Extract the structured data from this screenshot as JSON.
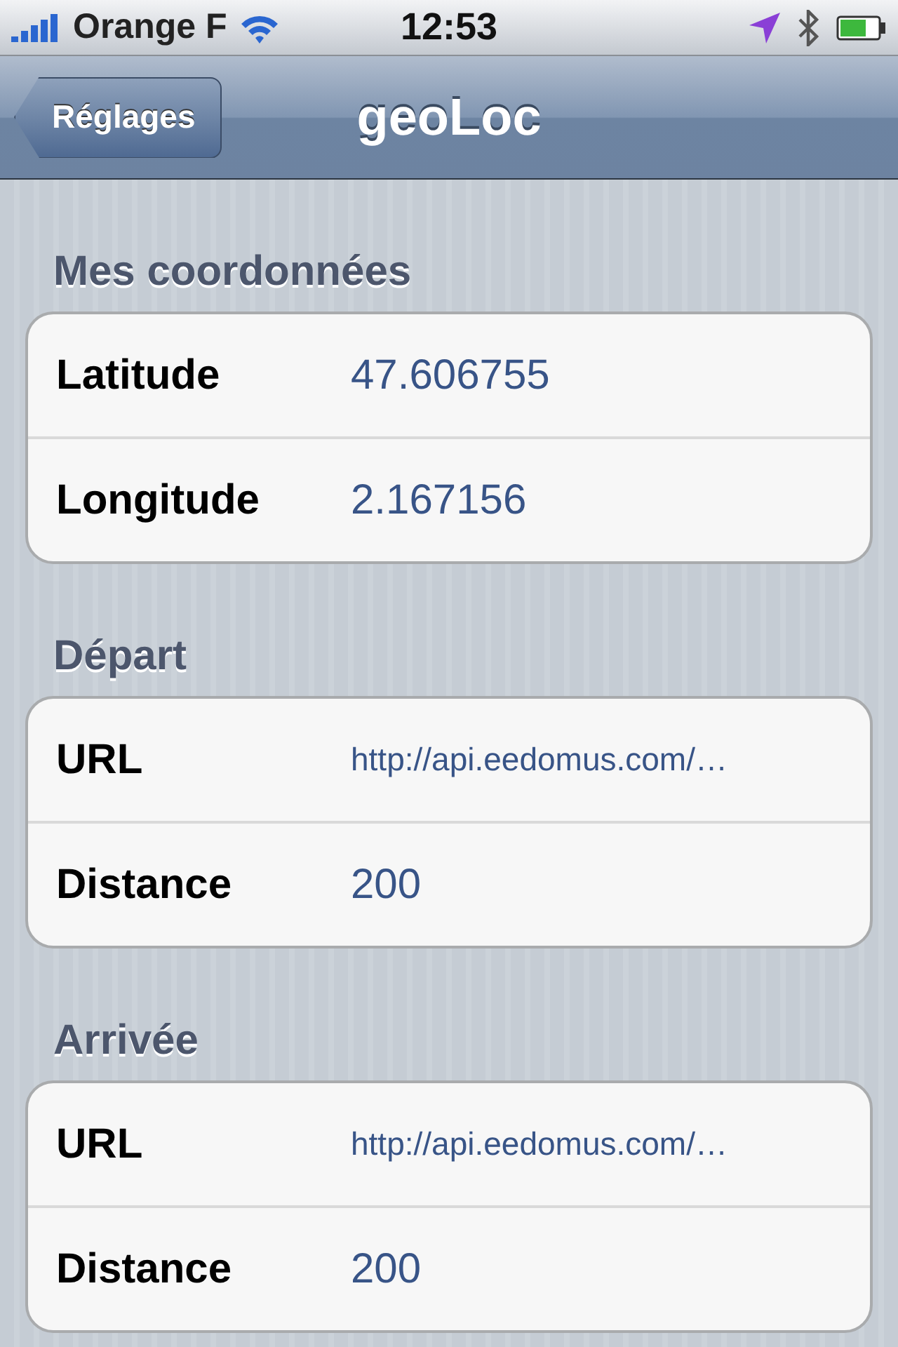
{
  "status_bar": {
    "carrier": "Orange F",
    "time": "12:53"
  },
  "nav_bar": {
    "back_button": "Réglages",
    "title": "geoLoc"
  },
  "sections": [
    {
      "header": "Mes coordonnées",
      "rows": [
        {
          "kind": "plain",
          "label": "Latitude",
          "value": "47.606755"
        },
        {
          "kind": "plain",
          "label": "Longitude",
          "value": "2.167156"
        }
      ]
    },
    {
      "header": "Départ",
      "rows": [
        {
          "kind": "url",
          "label": "URL",
          "value": "http://api.eedomus.com/…"
        },
        {
          "kind": "plain",
          "label": "Distance",
          "value": "200"
        }
      ]
    },
    {
      "header": "Arrivée",
      "rows": [
        {
          "kind": "url",
          "label": "URL",
          "value": "http://api.eedomus.com/…"
        },
        {
          "kind": "plain",
          "label": "Distance",
          "value": "200"
        }
      ]
    }
  ]
}
